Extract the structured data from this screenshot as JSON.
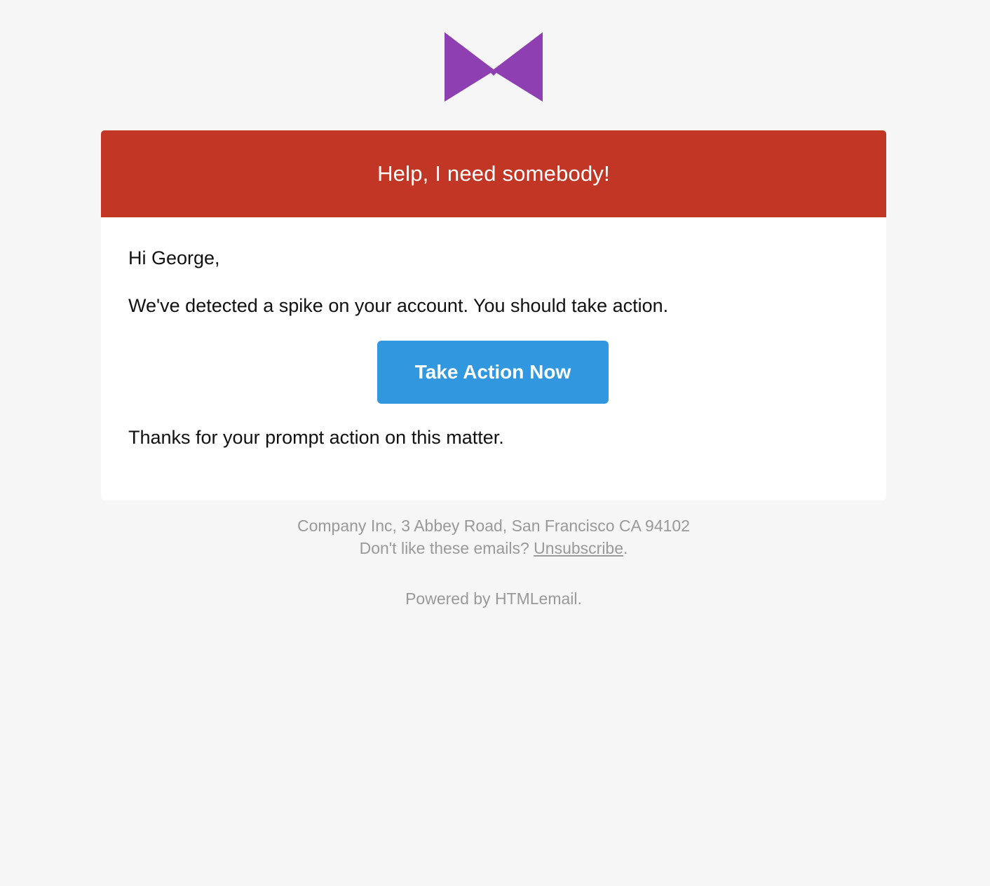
{
  "logo": {
    "icon": "bowtie-logo-icon",
    "color": "#8e3fb2"
  },
  "alert": {
    "title": "Help, I need somebody!",
    "color": "#c13624"
  },
  "email": {
    "greeting": "Hi George,",
    "message": "We've detected a spike on your account. You should take action.",
    "cta_label": "Take Action Now",
    "cta_color": "#3198df",
    "closing": "Thanks for your prompt action on this matter."
  },
  "footer": {
    "address": "Company Inc, 3 Abbey Road, San Francisco CA 94102",
    "unsubscribe_prefix": "Don't like these emails? ",
    "unsubscribe_link": "Unsubscribe",
    "unsubscribe_suffix": ".",
    "powered_prefix": "Powered by ",
    "powered_link": "HTMLemail",
    "powered_suffix": "."
  }
}
